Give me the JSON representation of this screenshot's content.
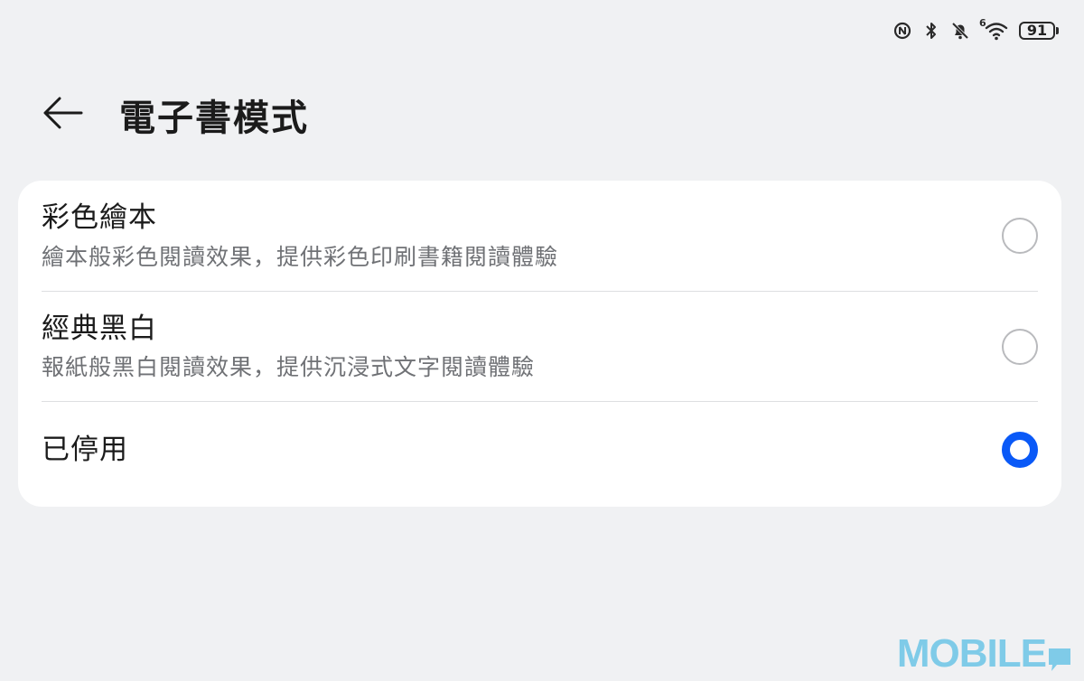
{
  "status_bar": {
    "icons": [
      "nfc-icon",
      "bluetooth-icon",
      "bell-off-icon",
      "wifi-icon"
    ],
    "wifi_generation": "6",
    "battery_level": "91"
  },
  "header": {
    "back_icon": "arrow-left-icon",
    "title": "電子書模式"
  },
  "options": [
    {
      "title": "彩色繪本",
      "description": "繪本般彩色閱讀效果，提供彩色印刷書籍閱讀體驗",
      "selected": false
    },
    {
      "title": "經典黑白",
      "description": "報紙般黑白閱讀效果，提供沉浸式文字閱讀體驗",
      "selected": false
    },
    {
      "title": "已停用",
      "selected": true
    }
  ],
  "colors": {
    "background": "#f0f1f3",
    "card": "#ffffff",
    "accent": "#0a59f7",
    "primary_text": "#1b1b1b",
    "secondary_text": "#6f7175"
  },
  "watermark": {
    "text": "MOBILE"
  }
}
